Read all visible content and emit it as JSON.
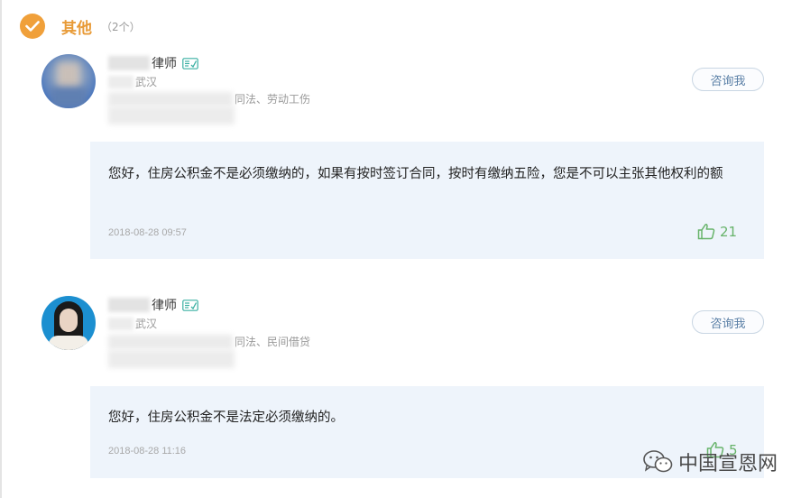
{
  "section": {
    "title": "其他",
    "count": "（2个）"
  },
  "lawyers": [
    {
      "name_suffix": "律师",
      "location": "武汉",
      "specialty": "同法、劳动工伤",
      "consult_label": "咨询我",
      "answer": "您好，住房公积金不是必须缴纳的，如果有按时签订合同，按时有缴纳五险，您是不可以主张其他权利的额",
      "date": "2018-08-28 09:57",
      "likes": "21"
    },
    {
      "name_suffix": "律师",
      "location": "武汉",
      "specialty": "同法、民间借贷",
      "consult_label": "咨询我",
      "answer": "您好，住房公积金不是法定必须缴纳的。",
      "date": "2018-08-28 11:16",
      "likes": "5"
    }
  ],
  "watermark": {
    "text": "中国宣恩网"
  },
  "colors": {
    "accent": "#f0a03a",
    "answer_bg": "#eef4fb",
    "like_green": "#67b36a",
    "button_border": "#c9d6e3"
  },
  "icons": [
    "check-icon",
    "certified-icon",
    "thumbs-up-icon",
    "wechat-icon"
  ]
}
